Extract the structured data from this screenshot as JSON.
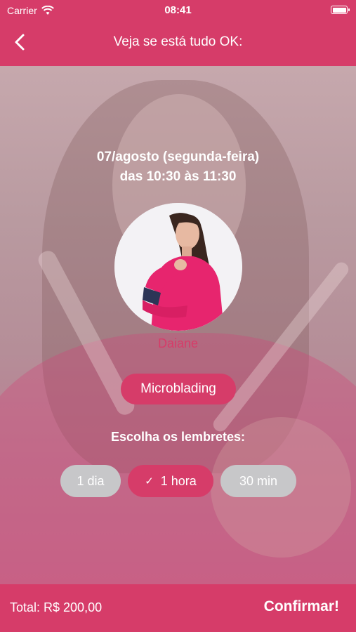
{
  "status_bar": {
    "carrier": "Carrier",
    "time": "08:41"
  },
  "nav": {
    "title": "Veja se está tudo OK:"
  },
  "appointment": {
    "date": "07/agosto (segunda-feira)",
    "time_range": "das 10:30 às 11:30"
  },
  "professional": {
    "name": "Daiane"
  },
  "service": {
    "label": "Microblading"
  },
  "reminders": {
    "title": "Escolha os lembretes:",
    "options": [
      {
        "label": "1 dia",
        "selected": false
      },
      {
        "label": "1 hora",
        "selected": true
      },
      {
        "label": "30 min",
        "selected": false
      }
    ]
  },
  "footer": {
    "total": "Total: R$ 200,00",
    "confirm_label": "Confirmar!"
  },
  "colors": {
    "accent": "#d63c69",
    "chip_off": "#c7c7c9"
  }
}
